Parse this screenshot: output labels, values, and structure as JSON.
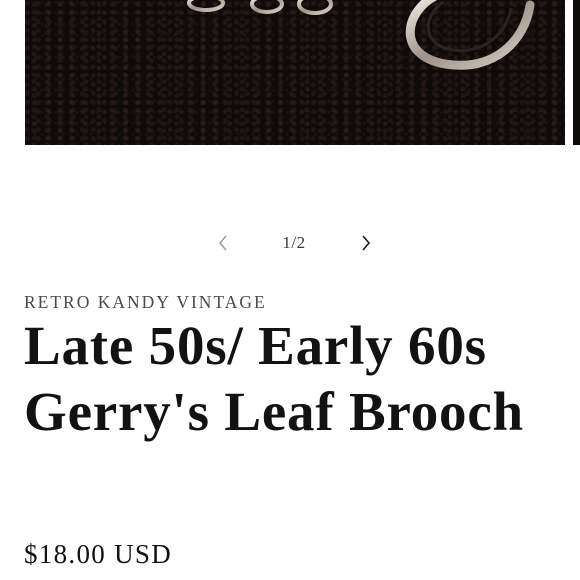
{
  "gallery": {
    "counter": "1/2",
    "prev_icon": "chevron-left-icon",
    "next_icon": "chevron-right-icon"
  },
  "product": {
    "vendor": "RETRO KANDY VINTAGE",
    "title": "Late 50s/ Early 60s Gerry's Leaf Brooch",
    "price": "$18.00 USD"
  },
  "colors": {
    "photo_background": "#0d0a09",
    "text": "#121212",
    "muted_text": "#4a4a4a"
  }
}
